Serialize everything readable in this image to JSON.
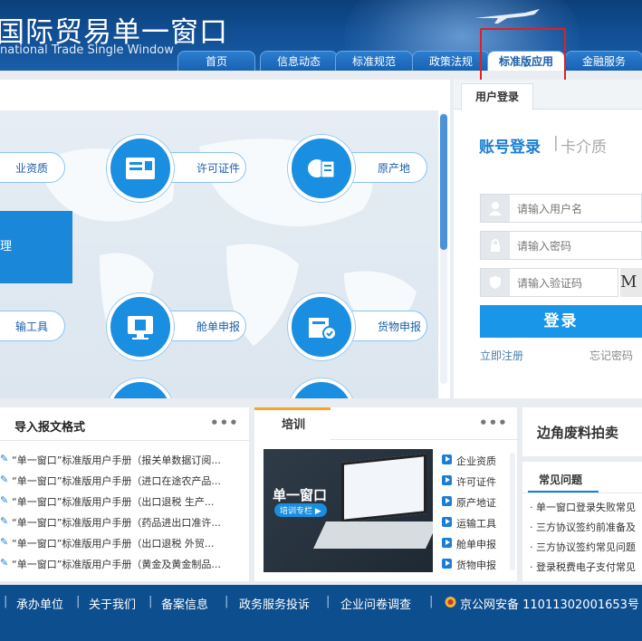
{
  "header": {
    "title": "国际贸易单一窗口",
    "subtitle": "national Trade Single  Window",
    "nav": [
      "首页",
      "信息动态",
      "标准规范",
      "政策法规",
      "标准版应用",
      "金融服务"
    ],
    "active_nav": "标准版应用"
  },
  "services": [
    {
      "label": "业资质",
      "icon": "certificate-icon"
    },
    {
      "label": "许可证件",
      "icon": "license-icon"
    },
    {
      "label": "原产地",
      "icon": "origin-icon"
    },
    {
      "label": "输工具",
      "icon": "transport-icon"
    },
    {
      "label": "舱单申报",
      "icon": "manifest-icon"
    },
    {
      "label": "货物申报",
      "icon": "cargo-icon"
    }
  ],
  "blue_block_label": "理",
  "login": {
    "tab": "用户登录",
    "mode_active": "账号登录",
    "separator": "|",
    "mode_inactive": "卡介质",
    "username_placeholder": "请输入用户名",
    "password_placeholder": "请输入密码",
    "captcha_placeholder": "请输入验证码",
    "captcha_text": "M",
    "button": "登录",
    "register": "立即注册",
    "forgot": "忘记密码"
  },
  "docs": {
    "title": "导入报文格式",
    "more": "•••",
    "items": [
      "“单一窗口”标准版用户手册（报关单数据订阅...",
      "“单一窗口”标准版用户手册（进口在途农产品...",
      "“单一窗口”标准版用户手册（出口退税 生产...",
      "“单一窗口”标准版用户手册（药品进出口准许...",
      "“单一窗口”标准版用户手册（出口退税 外贸...",
      "“单一窗口”标准版用户手册（黄金及黄金制品..."
    ]
  },
  "training": {
    "title": "培训",
    "more": "•••",
    "image_title": "单一窗口",
    "image_sub": "培训专栏 ▶",
    "links": [
      "企业资质",
      "许可证件",
      "原产地证",
      "运输工具",
      "舱单申报",
      "货物申报"
    ]
  },
  "auction": {
    "title": "边角废料拍卖"
  },
  "faq": {
    "tab": "常见问题",
    "items": [
      "· 单一窗口登录失败常见",
      "· 三方协议签约前准备及",
      "· 三方协议签约常见问题",
      "· 登录税费电子支付常见"
    ]
  },
  "footer": {
    "items": [
      "承办单位",
      "关于我们",
      "备案信息",
      "政务服务投诉",
      "企业问卷调查"
    ],
    "separator": "|",
    "icp": "京公网安备 11011302001653号"
  },
  "colors": {
    "brand": "#1a5ea8",
    "accent": "#1a96e8",
    "highlight": "#e02020"
  }
}
